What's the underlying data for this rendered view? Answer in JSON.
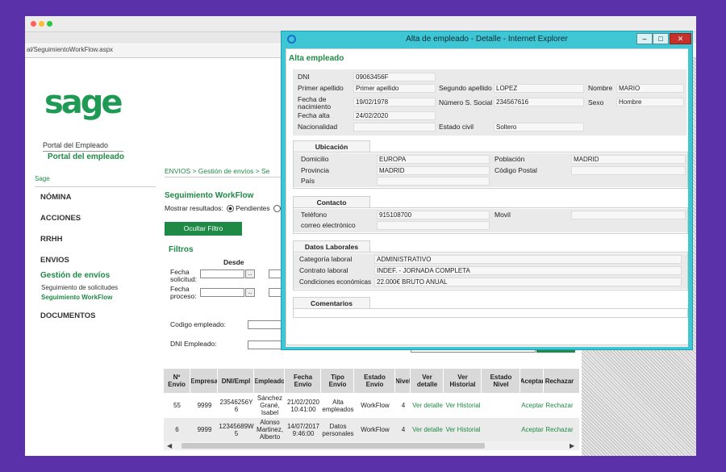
{
  "browser": {
    "url": "al/SeguimientoWorkFlow.aspx",
    "colors": {
      "close": "#ff5f57",
      "min": "#febc2e",
      "max": "#28c840"
    }
  },
  "sidebar": {
    "logo": "sage",
    "portal_title": "Portal del Empleado",
    "portal_subtitle": "Portal del empleado",
    "brand_link": "Sage",
    "items": [
      "NÓMINA",
      "ACCIONES",
      "RRHH",
      "ENVIOS"
    ],
    "selected": "Gestión de envíos",
    "sub_items": [
      "Seguimiento de solicitudes",
      "Seguimiento WorkFlow"
    ],
    "last_item": "DOCUMENTOS"
  },
  "main": {
    "breadcrumb": "ENVIOS   >   Gestión de envíos   >   Se",
    "title": "Seguimiento WorkFlow",
    "mostrar_label": "Mostrar resultados:",
    "radio_pendientes": "Pendientes",
    "ocultar_button": "Ocultar Filtro",
    "filtros": "Filtros",
    "desde": "Desde",
    "fecha_solicitud": "Fecha solicitud:",
    "fecha_proceso": "Fecha proceso:",
    "codigo_empleado": "Codigo empleado:",
    "dni_empleado": "DNI Empleado:",
    "calendar_button": "...",
    "table": {
      "headers": [
        "Nº Envío",
        "Empresa",
        "DNI/Empl",
        "Empleado",
        "Fecha Envío",
        "Tipo Envío",
        "Estado Envío",
        "Nivel",
        "Ver detalle",
        "Ver Historial",
        "Estado Nivel",
        "Aceptar",
        "Rechazar"
      ],
      "rows": [
        [
          "55",
          "9999",
          "23546256Y 6",
          "Sánchez Grané, Isabel",
          "21/02/2020 10:41:00",
          "Alta empleados",
          "WorkFlow",
          "4",
          "Ver detalle",
          "Ver Historial",
          "",
          "Aceptar",
          "Rechazar"
        ],
        [
          "6",
          "9999",
          "12345689W 5",
          "Alonso Martinez, Alberto",
          "14/07/2017 9:46:00",
          "Datos personales",
          "WorkFlow",
          "4",
          "Ver detalle",
          "Ver Historial",
          "",
          "Aceptar",
          "Rechazar"
        ]
      ]
    }
  },
  "modal": {
    "title": "Alta de empleado - Detalle - Internet Explorer",
    "heading": "Alta empleado",
    "buttons": {
      "minimize": "–",
      "maximize": "□",
      "close": "✕"
    },
    "general": {
      "dni_label": "DNI",
      "dni": "09063456F",
      "apellido1_label": "Primer apellido",
      "apellido1": "Primer apellido",
      "apellido2_label": "Segundo apellido",
      "apellido2": "LOPEZ",
      "nombre_label": "Nombre",
      "nombre": "MARIO",
      "fecha_nac_label": "Fecha de nacimiento",
      "fecha_nac": "19/02/1978",
      "nss_label": "Número S. Social",
      "nss": "234567616",
      "sexo_label": "Sexo",
      "sexo": "Hombre",
      "fecha_alta_label": "Fecha alta",
      "fecha_alta": "24/02/2020",
      "nacionalidad_label": "Nacionalidad",
      "nacionalidad": "",
      "estado_civil_label": "Estado civil",
      "estado_civil": "Soltero"
    },
    "ubicacion": {
      "tab": "Ubicación",
      "domicilio_label": "Domicilio",
      "domicilio": "EUROPA",
      "poblacion_label": "Población",
      "poblacion": "MADRID",
      "provincia_label": "Provincia",
      "provincia": "MADRID",
      "codigo_postal_label": "Código Postal",
      "codigo_postal": "",
      "pais_label": "País",
      "pais": ""
    },
    "contacto": {
      "tab": "Contacto",
      "telefono_label": "Teléfono",
      "telefono": "915108700",
      "movil_label": "Movil",
      "movil": "",
      "correo_label": "correo electrónico",
      "correo": ""
    },
    "laborales": {
      "tab": "Datos Laborales",
      "categoria_label": "Categoría laboral",
      "categoria": "ADMINISTRATIVO",
      "contrato_label": "Contrato laboral",
      "contrato": "INDEF. - JORNADA COMPLETA",
      "condiciones_label": "Condiciones económicas",
      "condiciones": "22.000€ BRUTO ANUAL"
    },
    "comentarios": {
      "tab": "Comentarios"
    }
  }
}
